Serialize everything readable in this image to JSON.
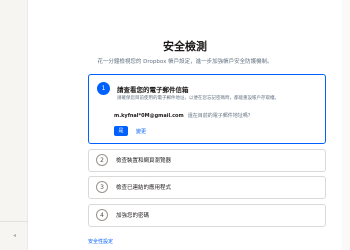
{
  "page": {
    "title": "安全檢測",
    "subtitle": "花一分鐘檢視您的 Dropbox 帳戶設定，進一步加強帳戶安全防護機制。"
  },
  "step1": {
    "number": "1",
    "title": "請查看您的電子郵件信箱",
    "description": "請確保您目前使用的電子郵件地址，以便在您忘記密碼時，都能重設帳戶存取權。",
    "email": "m.kyfnal*0M@gmail.com",
    "email_question": "還在目前的電子郵件地址嗎？",
    "confirm_label": "是",
    "change_label": "變更"
  },
  "steps": [
    {
      "number": "2",
      "label": "檢查裝置和網頁瀏覽器"
    },
    {
      "number": "3",
      "label": "檢查已連結的應用程式"
    },
    {
      "number": "4",
      "label": "加強您的密碼"
    }
  ],
  "footer": {
    "link": "安全性設定"
  },
  "colors": {
    "accent": "#0061fe",
    "text": "#1e1919",
    "muted": "#637282",
    "border": "#dbd9d5",
    "sidebar": "#f7f5f2"
  }
}
